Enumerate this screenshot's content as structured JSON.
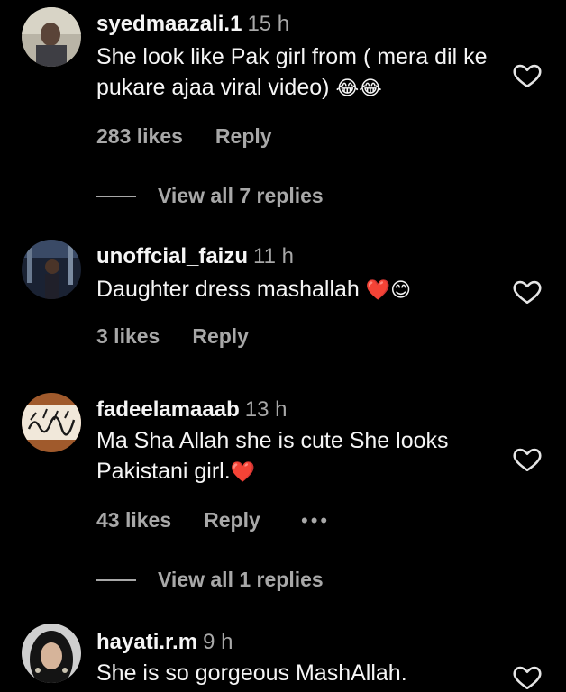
{
  "comments": [
    {
      "username": "syedmaazali.1",
      "time": "15 h",
      "text": "She look like Pak girl from ( mera dil ke pukare ajaa viral video)",
      "emoji": "😂😂",
      "likes": "283 likes",
      "reply": "Reply",
      "view_replies": "View all 7 replies"
    },
    {
      "username": "unoffcial_faizu",
      "time": "11 h",
      "text": "Daughter dress mashallah",
      "emoji": "❤️😊",
      "likes": "3 likes",
      "reply": "Reply"
    },
    {
      "username": "fadeelamaaab",
      "time": "13 h",
      "text": "Ma Sha Allah she is cute She looks Pakistani girl.",
      "emoji": "❤️",
      "likes": "43 likes",
      "reply": "Reply",
      "more": "•••",
      "view_replies": "View all 1 replies"
    },
    {
      "username": "hayati.r.m",
      "time": "9 h",
      "text": "She is so gorgeous MashAllah."
    }
  ],
  "icons": {
    "heart": "heart-outline-icon",
    "more": "more-options-icon"
  },
  "colors": {
    "background": "#000000",
    "primary_text": "#f5f5f5",
    "secondary_text": "#a8a8a8"
  }
}
